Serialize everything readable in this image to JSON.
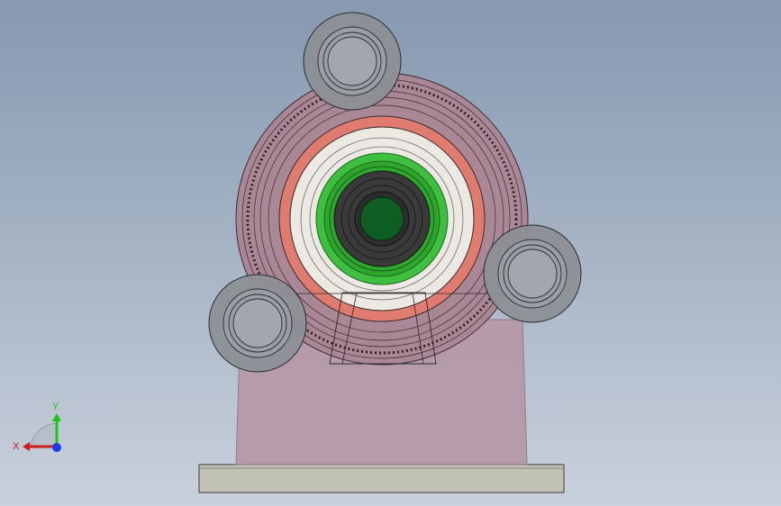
{
  "viewport": {
    "colors": {
      "background_top": "#8699b1",
      "background_bottom": "#c9d1dc",
      "base_plate": "#c2c3b4",
      "pedestal": "#b69aa9",
      "housing": "#a98795",
      "outer_ring": "#e07c6f",
      "inner_ring": "#ece9e3",
      "seal": "#3fbf3f",
      "bearing_bore": "#3a3a3a",
      "shaft": "#0e5d22",
      "idler_roller": "#8c9096"
    }
  },
  "triad": {
    "x_label": "X",
    "y_label": "Y",
    "x_color": "#d11a1a",
    "y_color": "#1ec41e",
    "z_color": "#1a3be6"
  }
}
